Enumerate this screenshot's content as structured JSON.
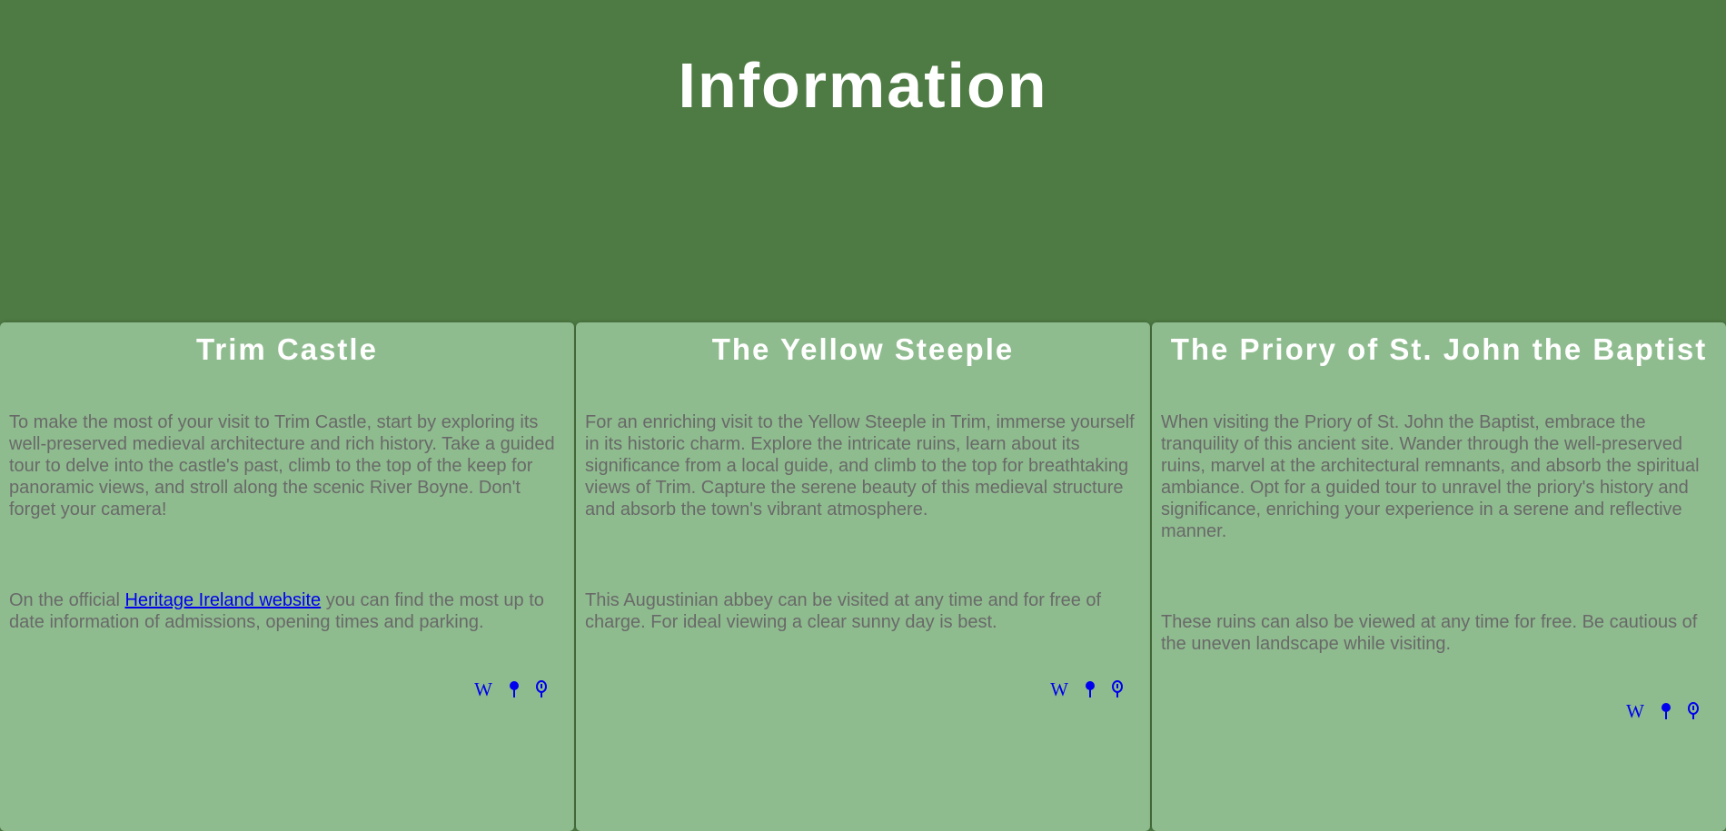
{
  "header": {
    "title": "Information"
  },
  "cards": [
    {
      "title": "Trim Castle",
      "paragraph1": "To make the most of your visit to Trim Castle, start by exploring its well-preserved medieval architecture and rich history. Take a guided tour to delve into the castle's past, climb to the top of the keep for panoramic views, and stroll along the scenic River Boyne. Don't forget your camera!",
      "paragraph2_before": "On the official ",
      "paragraph2_link": "Heritage Ireland website",
      "paragraph2_after": " you can find the most up to date information of admissions, opening times and parking.",
      "icons": [
        "wikipedia-icon",
        "map-pin-icon",
        "balloon-pin-icon"
      ]
    },
    {
      "title": "The Yellow Steeple",
      "paragraph1": "For an enriching visit to the Yellow Steeple in Trim, immerse yourself in its historic charm. Explore the intricate ruins, learn about its significance from a local guide, and climb to the top for breathtaking views of Trim. Capture the serene beauty of this medieval structure and absorb the town's vibrant atmosphere.",
      "paragraph2": "This Augustinian abbey can be visited at any time and for free of charge. For ideal viewing a clear sunny day is best.",
      "icons": [
        "wikipedia-icon",
        "map-pin-icon",
        "balloon-pin-icon"
      ]
    },
    {
      "title": "The Priory of St. John the Baptist",
      "paragraph1": "When visiting the Priory of St. John the Baptist, embrace the tranquility of this ancient site. Wander through the well-preserved ruins, marvel at the architectural remnants, and absorb the spiritual ambiance. Opt for a guided tour to unravel the priory's history and significance, enriching your experience in a serene and reflective manner.",
      "paragraph2": "These ruins can also be viewed at any time for free. Be cautious of the uneven landscape while visiting.",
      "icons": [
        "wikipedia-icon",
        "map-pin-icon",
        "balloon-pin-icon"
      ]
    }
  ],
  "icon_glyphs": {
    "wikipedia": "W"
  },
  "colors": {
    "header_bg": "#4e7b43",
    "card_bg": "#8fbc8f",
    "title_text": "#ffffff",
    "body_text": "#696969",
    "link": "#0000ee"
  }
}
